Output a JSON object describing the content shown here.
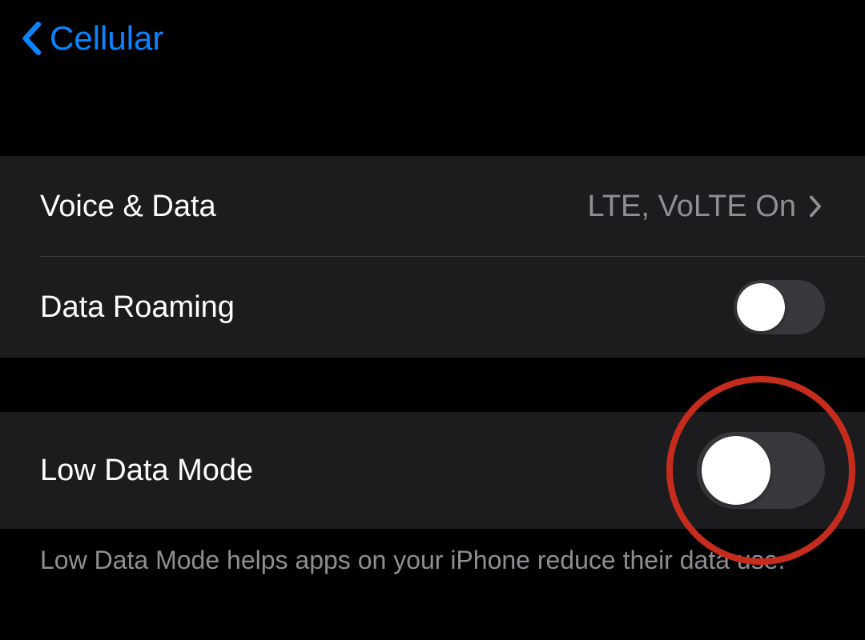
{
  "nav": {
    "back_label": "Cellular"
  },
  "group1": {
    "voice_data": {
      "label": "Voice & Data",
      "value": "LTE, VoLTE On"
    },
    "data_roaming": {
      "label": "Data Roaming",
      "toggle_on": false
    }
  },
  "group2": {
    "low_data_mode": {
      "label": "Low Data Mode",
      "toggle_on": false
    },
    "footer": "Low Data Mode helps apps on your iPhone reduce their data use."
  }
}
